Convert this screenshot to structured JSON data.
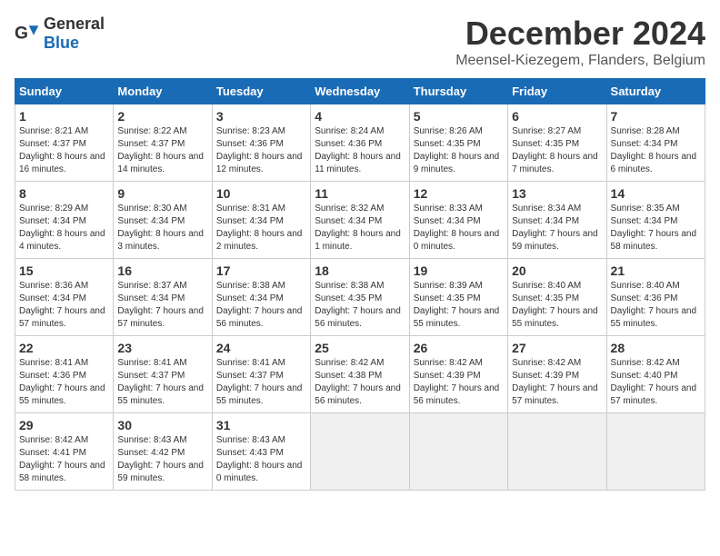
{
  "logo": {
    "general": "General",
    "blue": "Blue"
  },
  "title": "December 2024",
  "location": "Meensel-Kiezegem, Flanders, Belgium",
  "weekdays": [
    "Sunday",
    "Monday",
    "Tuesday",
    "Wednesday",
    "Thursday",
    "Friday",
    "Saturday"
  ],
  "weeks": [
    [
      {
        "day": "1",
        "sunrise": "Sunrise: 8:21 AM",
        "sunset": "Sunset: 4:37 PM",
        "daylight": "Daylight: 8 hours and 16 minutes."
      },
      {
        "day": "2",
        "sunrise": "Sunrise: 8:22 AM",
        "sunset": "Sunset: 4:37 PM",
        "daylight": "Daylight: 8 hours and 14 minutes."
      },
      {
        "day": "3",
        "sunrise": "Sunrise: 8:23 AM",
        "sunset": "Sunset: 4:36 PM",
        "daylight": "Daylight: 8 hours and 12 minutes."
      },
      {
        "day": "4",
        "sunrise": "Sunrise: 8:24 AM",
        "sunset": "Sunset: 4:36 PM",
        "daylight": "Daylight: 8 hours and 11 minutes."
      },
      {
        "day": "5",
        "sunrise": "Sunrise: 8:26 AM",
        "sunset": "Sunset: 4:35 PM",
        "daylight": "Daylight: 8 hours and 9 minutes."
      },
      {
        "day": "6",
        "sunrise": "Sunrise: 8:27 AM",
        "sunset": "Sunset: 4:35 PM",
        "daylight": "Daylight: 8 hours and 7 minutes."
      },
      {
        "day": "7",
        "sunrise": "Sunrise: 8:28 AM",
        "sunset": "Sunset: 4:34 PM",
        "daylight": "Daylight: 8 hours and 6 minutes."
      }
    ],
    [
      {
        "day": "8",
        "sunrise": "Sunrise: 8:29 AM",
        "sunset": "Sunset: 4:34 PM",
        "daylight": "Daylight: 8 hours and 4 minutes."
      },
      {
        "day": "9",
        "sunrise": "Sunrise: 8:30 AM",
        "sunset": "Sunset: 4:34 PM",
        "daylight": "Daylight: 8 hours and 3 minutes."
      },
      {
        "day": "10",
        "sunrise": "Sunrise: 8:31 AM",
        "sunset": "Sunset: 4:34 PM",
        "daylight": "Daylight: 8 hours and 2 minutes."
      },
      {
        "day": "11",
        "sunrise": "Sunrise: 8:32 AM",
        "sunset": "Sunset: 4:34 PM",
        "daylight": "Daylight: 8 hours and 1 minute."
      },
      {
        "day": "12",
        "sunrise": "Sunrise: 8:33 AM",
        "sunset": "Sunset: 4:34 PM",
        "daylight": "Daylight: 8 hours and 0 minutes."
      },
      {
        "day": "13",
        "sunrise": "Sunrise: 8:34 AM",
        "sunset": "Sunset: 4:34 PM",
        "daylight": "Daylight: 7 hours and 59 minutes."
      },
      {
        "day": "14",
        "sunrise": "Sunrise: 8:35 AM",
        "sunset": "Sunset: 4:34 PM",
        "daylight": "Daylight: 7 hours and 58 minutes."
      }
    ],
    [
      {
        "day": "15",
        "sunrise": "Sunrise: 8:36 AM",
        "sunset": "Sunset: 4:34 PM",
        "daylight": "Daylight: 7 hours and 57 minutes."
      },
      {
        "day": "16",
        "sunrise": "Sunrise: 8:37 AM",
        "sunset": "Sunset: 4:34 PM",
        "daylight": "Daylight: 7 hours and 57 minutes."
      },
      {
        "day": "17",
        "sunrise": "Sunrise: 8:38 AM",
        "sunset": "Sunset: 4:34 PM",
        "daylight": "Daylight: 7 hours and 56 minutes."
      },
      {
        "day": "18",
        "sunrise": "Sunrise: 8:38 AM",
        "sunset": "Sunset: 4:35 PM",
        "daylight": "Daylight: 7 hours and 56 minutes."
      },
      {
        "day": "19",
        "sunrise": "Sunrise: 8:39 AM",
        "sunset": "Sunset: 4:35 PM",
        "daylight": "Daylight: 7 hours and 55 minutes."
      },
      {
        "day": "20",
        "sunrise": "Sunrise: 8:40 AM",
        "sunset": "Sunset: 4:35 PM",
        "daylight": "Daylight: 7 hours and 55 minutes."
      },
      {
        "day": "21",
        "sunrise": "Sunrise: 8:40 AM",
        "sunset": "Sunset: 4:36 PM",
        "daylight": "Daylight: 7 hours and 55 minutes."
      }
    ],
    [
      {
        "day": "22",
        "sunrise": "Sunrise: 8:41 AM",
        "sunset": "Sunset: 4:36 PM",
        "daylight": "Daylight: 7 hours and 55 minutes."
      },
      {
        "day": "23",
        "sunrise": "Sunrise: 8:41 AM",
        "sunset": "Sunset: 4:37 PM",
        "daylight": "Daylight: 7 hours and 55 minutes."
      },
      {
        "day": "24",
        "sunrise": "Sunrise: 8:41 AM",
        "sunset": "Sunset: 4:37 PM",
        "daylight": "Daylight: 7 hours and 55 minutes."
      },
      {
        "day": "25",
        "sunrise": "Sunrise: 8:42 AM",
        "sunset": "Sunset: 4:38 PM",
        "daylight": "Daylight: 7 hours and 56 minutes."
      },
      {
        "day": "26",
        "sunrise": "Sunrise: 8:42 AM",
        "sunset": "Sunset: 4:39 PM",
        "daylight": "Daylight: 7 hours and 56 minutes."
      },
      {
        "day": "27",
        "sunrise": "Sunrise: 8:42 AM",
        "sunset": "Sunset: 4:39 PM",
        "daylight": "Daylight: 7 hours and 57 minutes."
      },
      {
        "day": "28",
        "sunrise": "Sunrise: 8:42 AM",
        "sunset": "Sunset: 4:40 PM",
        "daylight": "Daylight: 7 hours and 57 minutes."
      }
    ],
    [
      {
        "day": "29",
        "sunrise": "Sunrise: 8:42 AM",
        "sunset": "Sunset: 4:41 PM",
        "daylight": "Daylight: 7 hours and 58 minutes."
      },
      {
        "day": "30",
        "sunrise": "Sunrise: 8:43 AM",
        "sunset": "Sunset: 4:42 PM",
        "daylight": "Daylight: 7 hours and 59 minutes."
      },
      {
        "day": "31",
        "sunrise": "Sunrise: 8:43 AM",
        "sunset": "Sunset: 4:43 PM",
        "daylight": "Daylight: 8 hours and 0 minutes."
      },
      null,
      null,
      null,
      null
    ]
  ]
}
